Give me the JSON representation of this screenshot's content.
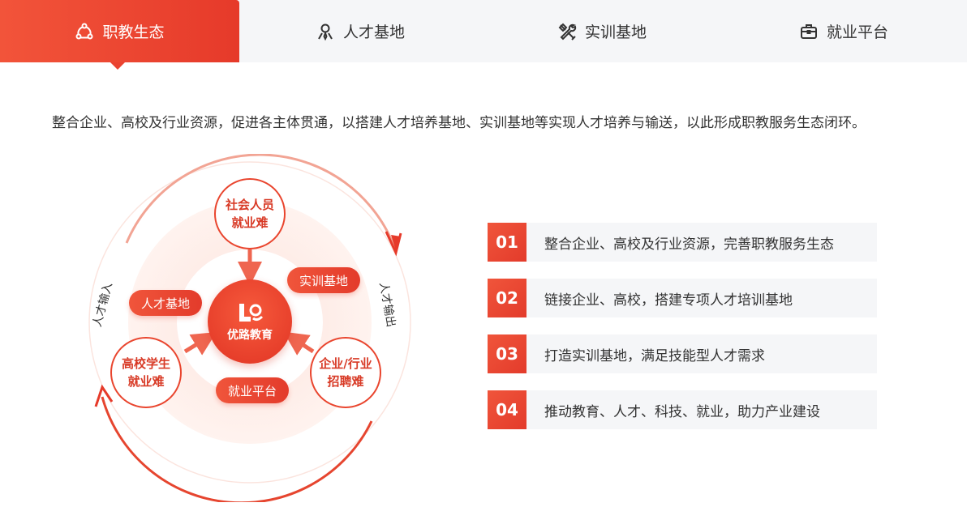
{
  "tabs": [
    {
      "label": "职教生态",
      "icon": "ecosystem-icon",
      "active": true
    },
    {
      "label": "人才基地",
      "icon": "person-icon",
      "active": false
    },
    {
      "label": "实训基地",
      "icon": "tools-icon",
      "active": false
    },
    {
      "label": "就业平台",
      "icon": "briefcase-icon",
      "active": false
    }
  ],
  "intro": "整合企业、高校及行业资源，促进各主体贯通，以搭建人才培养基地、实训基地等实现人才培养与输送，以此形成职教服务生态闭环。",
  "diagram": {
    "center": "优路教育",
    "nodes": {
      "top": "社会人员就业难",
      "top_line1": "社会人员",
      "top_line2": "就业难",
      "left_line1": "高校学生",
      "left_line2": "就业难",
      "right_line1": "企业/行业",
      "right_line2": "招聘难"
    },
    "pills": {
      "talent_base": "人才基地",
      "training_base": "实训基地",
      "job_platform": "就业平台"
    },
    "talent_in": "人才输入",
    "talent_out": "人才输出"
  },
  "list": [
    {
      "num": "01",
      "text": "整合企业、高校及行业资源，完善职教服务生态"
    },
    {
      "num": "02",
      "text": "链接企业、高校，搭建专项人才培训基地"
    },
    {
      "num": "03",
      "text": "打造实训基地，满足技能型人才需求"
    },
    {
      "num": "04",
      "text": "推动教育、人才、科技、就业，助力产业建设"
    }
  ],
  "colors": {
    "accent": "#e63a2a",
    "accent_light": "#f2543a",
    "tab_bg": "#f5f6f8"
  }
}
